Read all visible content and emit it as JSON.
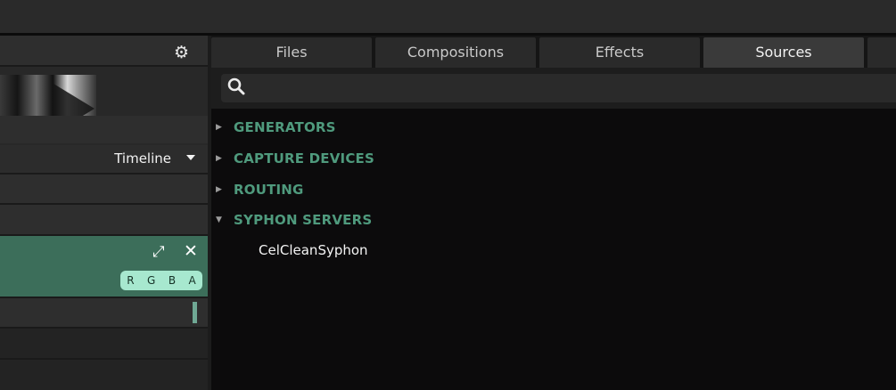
{
  "left_panel": {
    "timeline_label": "Timeline",
    "settings_icon": "gear-icon",
    "expand_icon": "expand-icon",
    "close_icon": "close-icon",
    "channels": [
      "R",
      "G",
      "B",
      "A"
    ],
    "accent_color": "#3c6e5a",
    "pill_color": "#a7e8cf"
  },
  "tabs": [
    {
      "label": "Files",
      "active": false
    },
    {
      "label": "Compositions",
      "active": false
    },
    {
      "label": "Effects",
      "active": false
    },
    {
      "label": "Sources",
      "active": true
    }
  ],
  "search": {
    "icon": "search-icon",
    "placeholder": ""
  },
  "categories": [
    {
      "label": "GENERATORS",
      "expanded": false
    },
    {
      "label": "CAPTURE DEVICES",
      "expanded": false
    },
    {
      "label": "ROUTING",
      "expanded": false
    },
    {
      "label": "SYPHON SERVERS",
      "expanded": true
    }
  ],
  "syphon_items": [
    "CelCleanSyphon"
  ],
  "category_color": "#4f9a7d"
}
